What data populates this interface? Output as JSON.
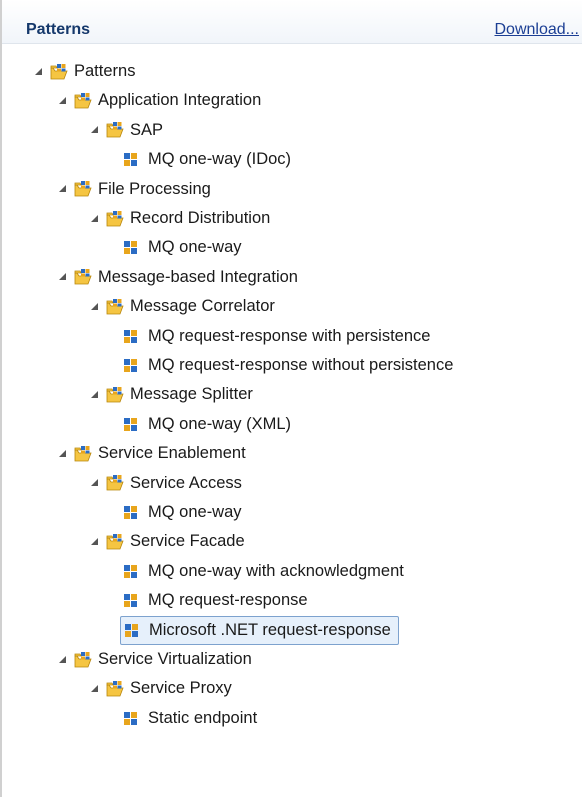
{
  "header": {
    "title": "Patterns",
    "download_label": "Download..."
  },
  "tree": [
    {
      "label": "Patterns",
      "level": 0,
      "kind": "folder",
      "expanded": true,
      "icon": "folder-pattern-icon"
    },
    {
      "label": "Application Integration",
      "level": 1,
      "kind": "folder",
      "expanded": true,
      "icon": "folder-pattern-icon"
    },
    {
      "label": "SAP",
      "level": 2,
      "kind": "folder",
      "expanded": true,
      "icon": "folder-pattern-icon"
    },
    {
      "label": "MQ one-way (IDoc)",
      "level": 3,
      "kind": "pattern",
      "icon": "pattern-icon"
    },
    {
      "label": "File Processing",
      "level": 1,
      "kind": "folder",
      "expanded": true,
      "icon": "folder-pattern-icon"
    },
    {
      "label": "Record Distribution",
      "level": 2,
      "kind": "folder",
      "expanded": true,
      "icon": "folder-pattern-icon"
    },
    {
      "label": "MQ one-way",
      "level": 3,
      "kind": "pattern",
      "icon": "pattern-icon"
    },
    {
      "label": "Message-based Integration",
      "level": 1,
      "kind": "folder",
      "expanded": true,
      "icon": "folder-pattern-icon"
    },
    {
      "label": "Message Correlator",
      "level": 2,
      "kind": "folder",
      "expanded": true,
      "icon": "folder-pattern-icon"
    },
    {
      "label": "MQ request-response with persistence",
      "level": 3,
      "kind": "pattern",
      "icon": "pattern-icon"
    },
    {
      "label": "MQ request-response without persistence",
      "level": 3,
      "kind": "pattern",
      "icon": "pattern-icon"
    },
    {
      "label": "Message Splitter",
      "level": 2,
      "kind": "folder",
      "expanded": true,
      "icon": "folder-pattern-icon"
    },
    {
      "label": "MQ one-way (XML)",
      "level": 3,
      "kind": "pattern",
      "icon": "pattern-icon"
    },
    {
      "label": "Service Enablement",
      "level": 1,
      "kind": "folder",
      "expanded": true,
      "icon": "folder-pattern-icon"
    },
    {
      "label": "Service Access",
      "level": 2,
      "kind": "folder",
      "expanded": true,
      "icon": "folder-pattern-icon"
    },
    {
      "label": "MQ one-way",
      "level": 3,
      "kind": "pattern",
      "icon": "pattern-icon"
    },
    {
      "label": "Service Facade",
      "level": 2,
      "kind": "folder",
      "expanded": true,
      "icon": "folder-pattern-icon"
    },
    {
      "label": "MQ one-way with acknowledgment",
      "level": 3,
      "kind": "pattern",
      "icon": "pattern-icon"
    },
    {
      "label": "MQ request-response",
      "level": 3,
      "kind": "pattern",
      "icon": "pattern-icon"
    },
    {
      "label": "Microsoft .NET request-response",
      "level": 3,
      "kind": "pattern",
      "icon": "pattern-icon",
      "selected": true
    },
    {
      "label": "Service Virtualization",
      "level": 1,
      "kind": "folder",
      "expanded": true,
      "icon": "folder-pattern-icon"
    },
    {
      "label": "Service Proxy",
      "level": 2,
      "kind": "folder",
      "expanded": true,
      "icon": "folder-pattern-icon"
    },
    {
      "label": "Static endpoint",
      "level": 3,
      "kind": "pattern",
      "icon": "pattern-icon"
    }
  ],
  "colors": {
    "selection_bg": "#e6f0fb",
    "selection_border": "#7da2ce",
    "title": "#15386b",
    "link": "#1c3f94"
  }
}
